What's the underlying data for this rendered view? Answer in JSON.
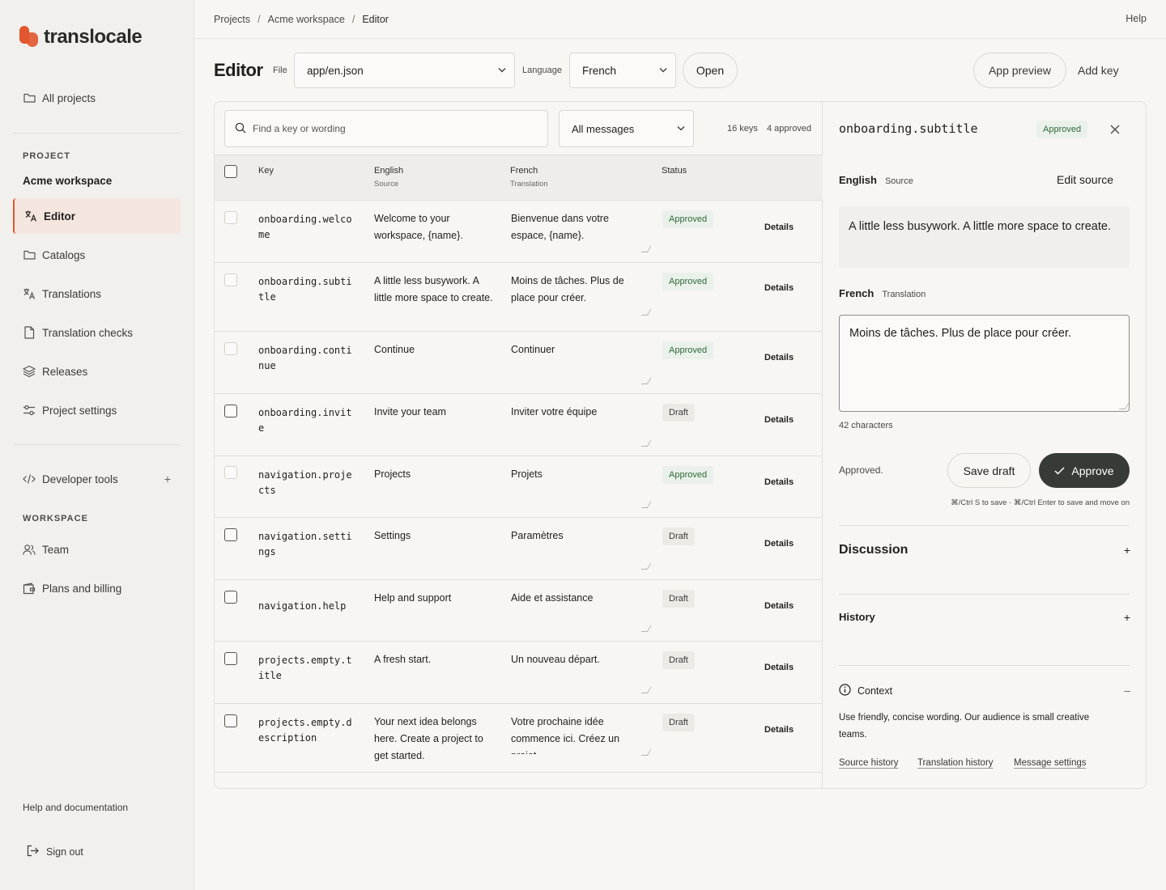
{
  "brand": {
    "name": "translocale",
    "accent": "#e2572f"
  },
  "sidebar": {
    "all_projects": "All projects",
    "project_label": "PROJECT",
    "project_name": "Acme workspace",
    "items": [
      {
        "label": "Editor",
        "icon": "translate-icon",
        "active": true
      },
      {
        "label": "Catalogs",
        "icon": "folder-icon"
      },
      {
        "label": "Translations",
        "icon": "translate-icon"
      },
      {
        "label": "Translation checks",
        "icon": "file-check-icon"
      },
      {
        "label": "Releases",
        "icon": "layers-icon"
      },
      {
        "label": "Project settings",
        "icon": "sliders-icon"
      }
    ],
    "developer_tools": "Developer tools",
    "workspace_label": "WORKSPACE",
    "team": "Team",
    "billing": "Plans and billing",
    "help_docs": "Help and documentation",
    "sign_out": "Sign out"
  },
  "topbar": {
    "breadcrumb": [
      "Projects",
      "Acme workspace",
      "Editor"
    ],
    "help": "Help"
  },
  "header": {
    "title": "Editor",
    "file_label": "File",
    "file_value": "app/en.json",
    "language_label": "Language",
    "language_value": "French",
    "open_button": "Open",
    "app_preview_button": "App preview",
    "add_key_button": "Add key"
  },
  "list": {
    "search_placeholder": "Find a key or wording",
    "filter_value": "All messages",
    "keys_count": "16 keys",
    "approved_count": "4 approved",
    "columns": {
      "key": "Key",
      "english": "English",
      "english_sub": "Source",
      "french": "French",
      "french_sub": "Translation",
      "status": "Status"
    },
    "details_label": "Details",
    "rows": [
      {
        "key": "onboarding.welcome",
        "en": "Welcome to your workspace, {name}.",
        "fr": "Bienvenue dans votre espace, {name}.",
        "status": "Approved"
      },
      {
        "key": "onboarding.subtitle",
        "en": "A little less busywork. A little more space to create.",
        "fr": "Moins de tâches. Plus de place pour créer.",
        "status": "Approved"
      },
      {
        "key": "onboarding.continue",
        "en": "Continue",
        "fr": "Continuer",
        "status": "Approved"
      },
      {
        "key": "onboarding.invite",
        "en": "Invite your team",
        "fr": "Inviter votre équipe",
        "status": "Draft"
      },
      {
        "key": "navigation.projects",
        "en": "Projects",
        "fr": "Projets",
        "status": "Approved"
      },
      {
        "key": "navigation.settings",
        "en": "Settings",
        "fr": "Paramètres",
        "status": "Draft"
      },
      {
        "key": "navigation.help",
        "en": "Help and support",
        "fr": "Aide et assistance",
        "status": "Draft"
      },
      {
        "key": "projects.empty.title",
        "en": "A fresh start.",
        "fr": "Un nouveau départ.",
        "status": "Draft"
      },
      {
        "key": "projects.empty.description",
        "en": "Your next idea belongs here. Create a project to get started.",
        "fr": "Votre prochaine idée commence ici. Créez un projet",
        "status": "Draft"
      }
    ]
  },
  "detail": {
    "key": "onboarding.subtitle",
    "status": "Approved",
    "source_label": "English",
    "source_sub": "Source",
    "edit_source": "Edit source",
    "source_text": "A little less busywork. A little more space to create.",
    "translation_label": "French",
    "translation_sub": "Translation",
    "translation_text": "Moins de tâches. Plus de place pour créer.",
    "char_count": "42 characters",
    "state_text": "Approved.",
    "save_draft": "Save draft",
    "approve": "Approve",
    "shortcut_hint": "⌘/Ctrl S to save · ⌘/Ctrl Enter to save and move on",
    "discussion": "Discussion",
    "history": "History",
    "context_title": "Context",
    "context_text": "Use friendly, concise wording. Our audience is small creative teams.",
    "links": [
      "Source history",
      "Translation history",
      "Message settings"
    ]
  }
}
